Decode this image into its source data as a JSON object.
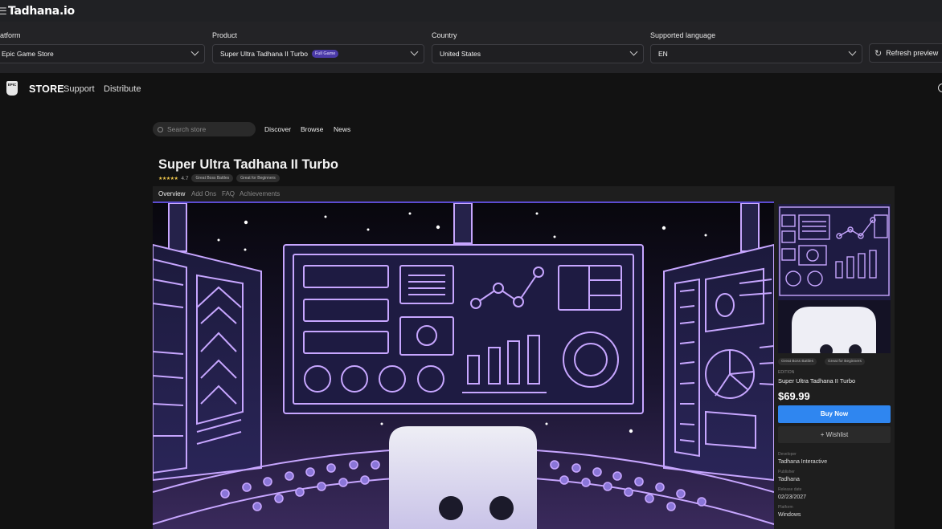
{
  "app": {
    "logo": "Tadhana.io",
    "menu_icon": "hamburger-icon"
  },
  "filters": {
    "platform": {
      "label": "atform",
      "value": "Epic Game Store"
    },
    "product": {
      "label": "Product",
      "value": "Super Ultra Tadhana II Turbo",
      "badge": "Full Game"
    },
    "country": {
      "label": "Country",
      "value": "United States"
    },
    "language": {
      "label": "Supported language",
      "value": "EN"
    },
    "refresh_label": "Refresh preview"
  },
  "store": {
    "logo_text": "EPIC",
    "store_label": "STORE",
    "nav": [
      "Support",
      "Distribute"
    ],
    "search_placeholder": "Search store",
    "subnav": [
      "Discover",
      "Browse",
      "News"
    ]
  },
  "game": {
    "title": "Super Ultra Tadhana II Turbo",
    "stars": "★★★★★",
    "rating": "4.7",
    "tags": [
      "Great Boss Battles",
      "Great for Beginners"
    ],
    "tabs": [
      "Overview",
      "Add Ons",
      "FAQ",
      "Achievements"
    ]
  },
  "sidebar": {
    "tags": [
      "Great Boss Battles",
      "Great for Beginners"
    ],
    "edition_label": "EDITION",
    "edition_name": "Super Ultra Tadhana II Turbo",
    "price": "$69.99",
    "buy_label": "Buy Now",
    "wishlist_label": "+ Wishlist",
    "info": [
      {
        "label": "Developer",
        "value": "Tadhana Interactive"
      },
      {
        "label": "Publisher",
        "value": "Tadhana"
      },
      {
        "label": "Release date",
        "value": "02/23/2027"
      },
      {
        "label": "Platform",
        "value": "Windows"
      }
    ]
  },
  "colors": {
    "accent_blue": "#2f86f0",
    "accent_purple": "#5b4bd0",
    "neon": "#c7a6ff"
  }
}
